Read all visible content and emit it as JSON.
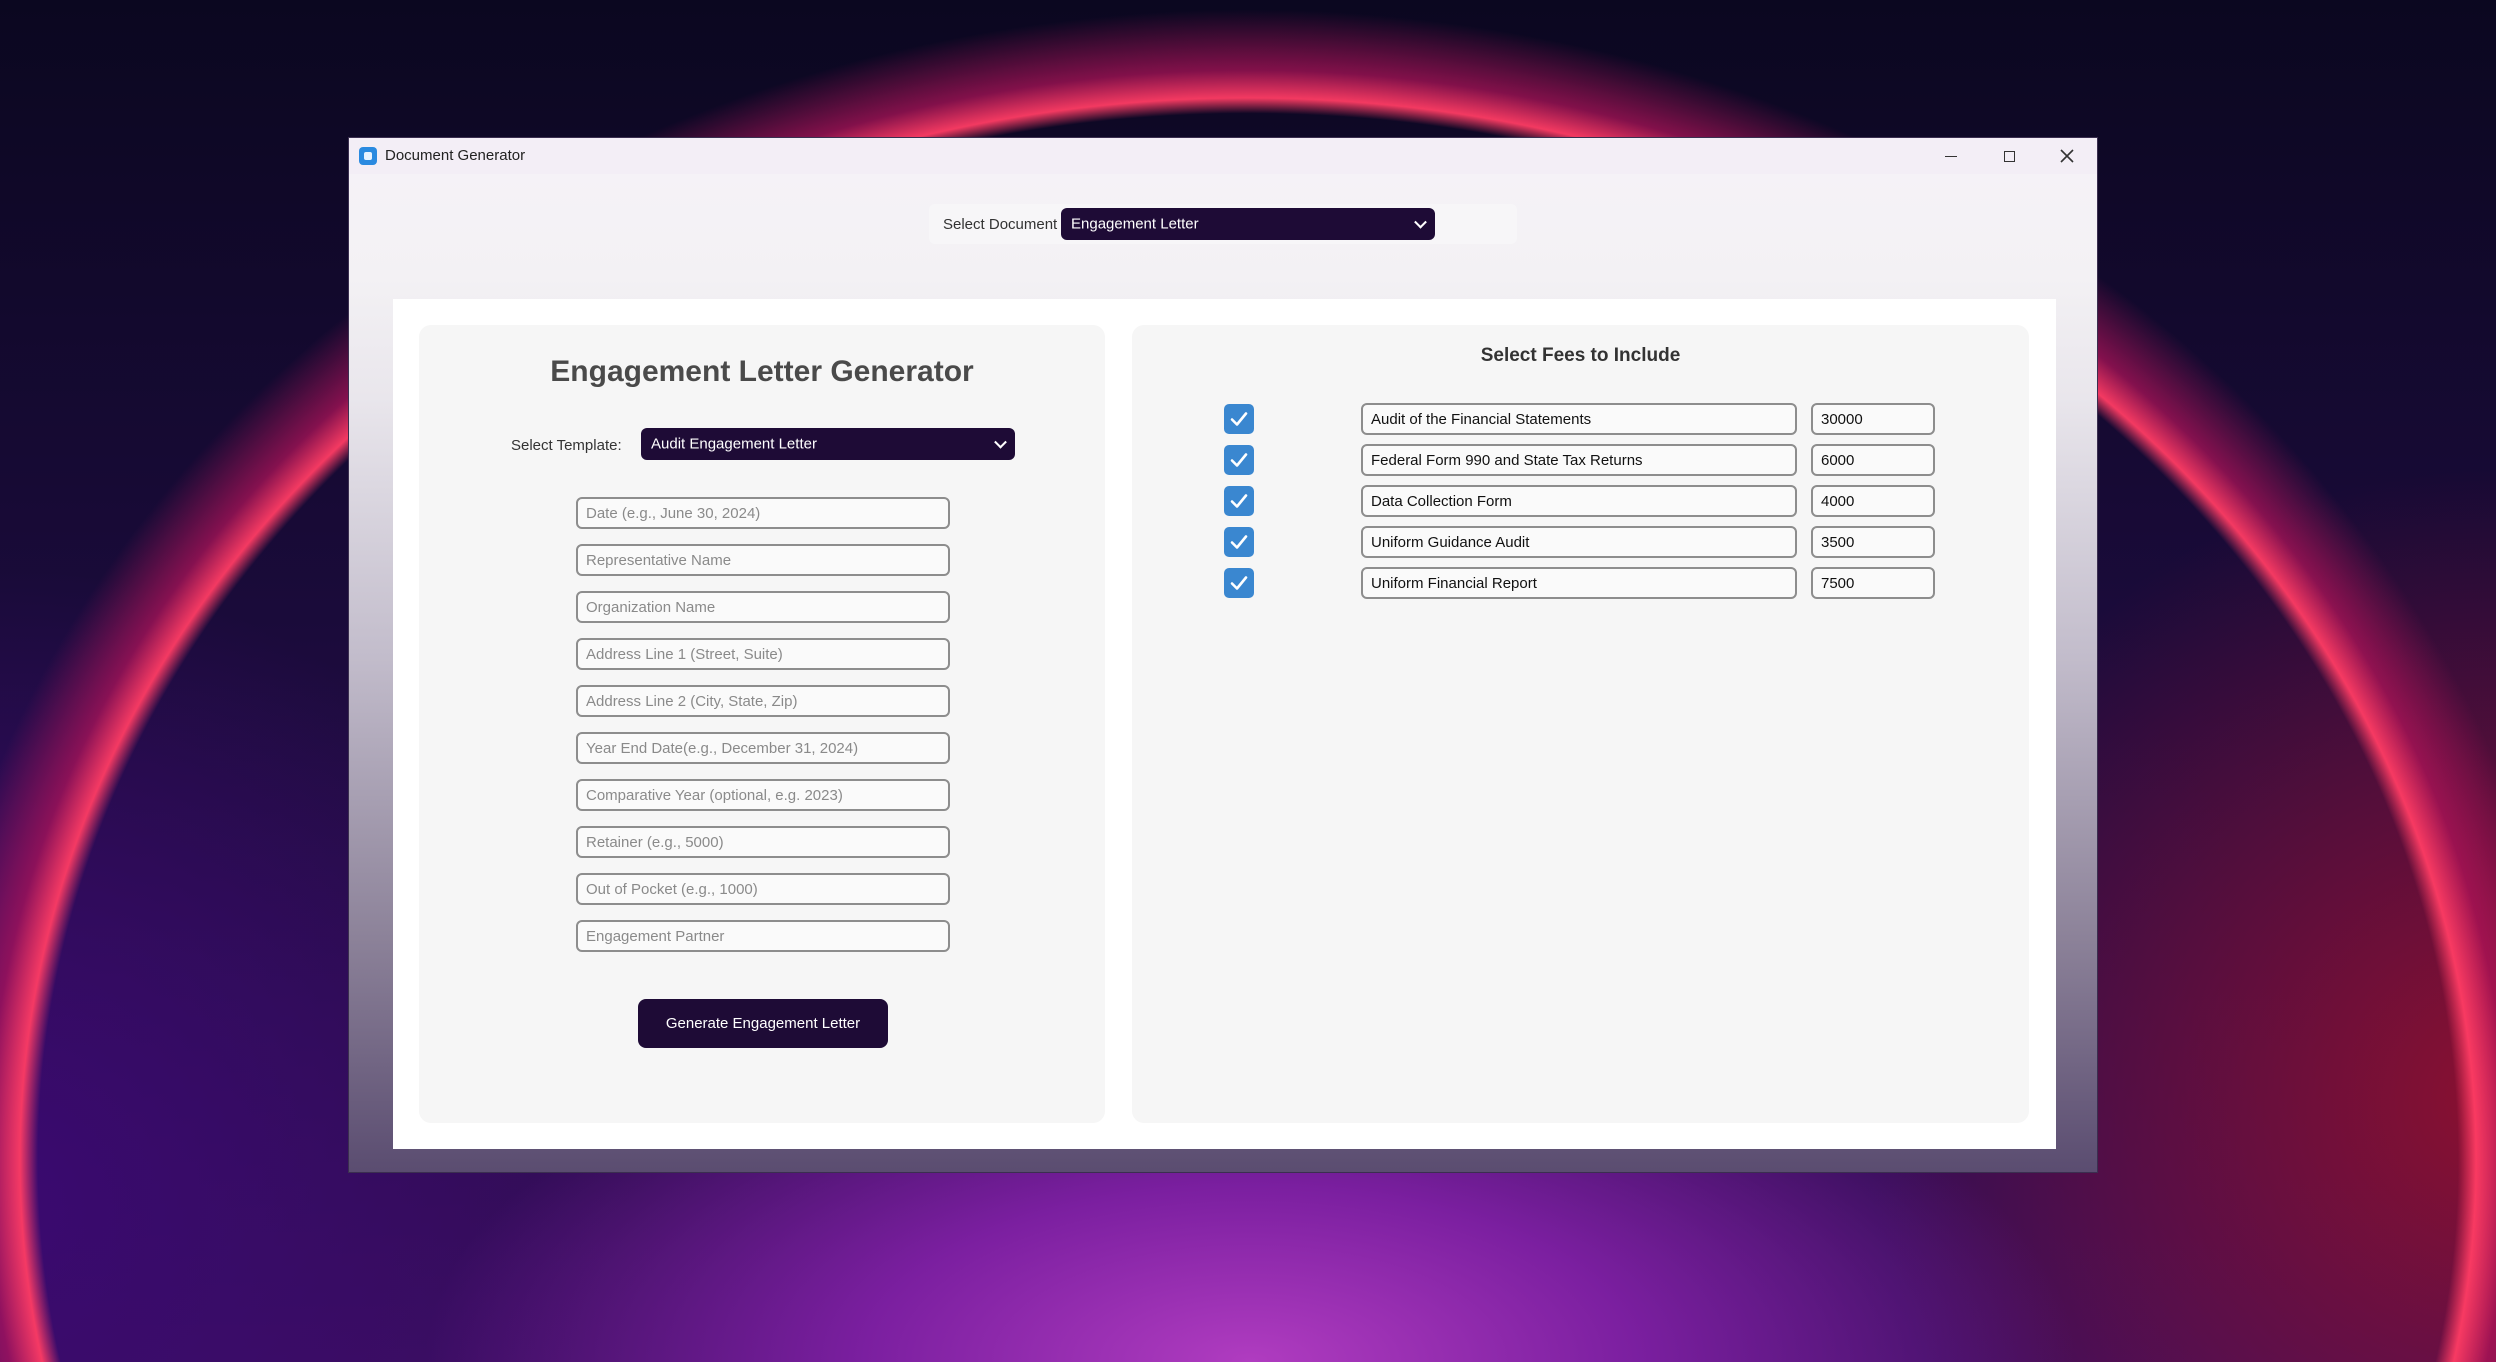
{
  "window": {
    "title": "Document Generator",
    "app_icon": "app-icon"
  },
  "doc_type": {
    "label": "Select Document Type:",
    "value": "Engagement Letter"
  },
  "left_panel": {
    "title": "Engagement Letter Generator",
    "template_label": "Select Template:",
    "template_value": "Audit Engagement Letter",
    "fields": [
      {
        "placeholder": "Date (e.g., June 30, 2024)",
        "value": ""
      },
      {
        "placeholder": "Representative Name",
        "value": ""
      },
      {
        "placeholder": "Organization Name",
        "value": ""
      },
      {
        "placeholder": "Address Line 1 (Street, Suite)",
        "value": ""
      },
      {
        "placeholder": "Address Line 2 (City, State, Zip)",
        "value": ""
      },
      {
        "placeholder": "Year End Date(e.g., December 31, 2024)",
        "value": ""
      },
      {
        "placeholder": "Comparative Year (optional, e.g. 2023)",
        "value": ""
      },
      {
        "placeholder": "Retainer (e.g., 5000)",
        "value": ""
      },
      {
        "placeholder": "Out of Pocket (e.g., 1000)",
        "value": ""
      },
      {
        "placeholder": "Engagement Partner",
        "value": ""
      }
    ],
    "generate_button": "Generate Engagement Letter"
  },
  "right_panel": {
    "title": "Select Fees to Include",
    "fees": [
      {
        "checked": true,
        "name": "Audit of the Financial Statements",
        "amount": "30000"
      },
      {
        "checked": true,
        "name": "Federal Form 990 and State Tax Returns",
        "amount": "6000"
      },
      {
        "checked": true,
        "name": "Data Collection Form",
        "amount": "4000"
      },
      {
        "checked": true,
        "name": "Uniform Guidance Audit",
        "amount": "3500"
      },
      {
        "checked": true,
        "name": "Uniform Financial Report",
        "amount": "7500"
      }
    ]
  },
  "colors": {
    "accent": "#1e0b36",
    "checkbox": "#3a87d0"
  }
}
